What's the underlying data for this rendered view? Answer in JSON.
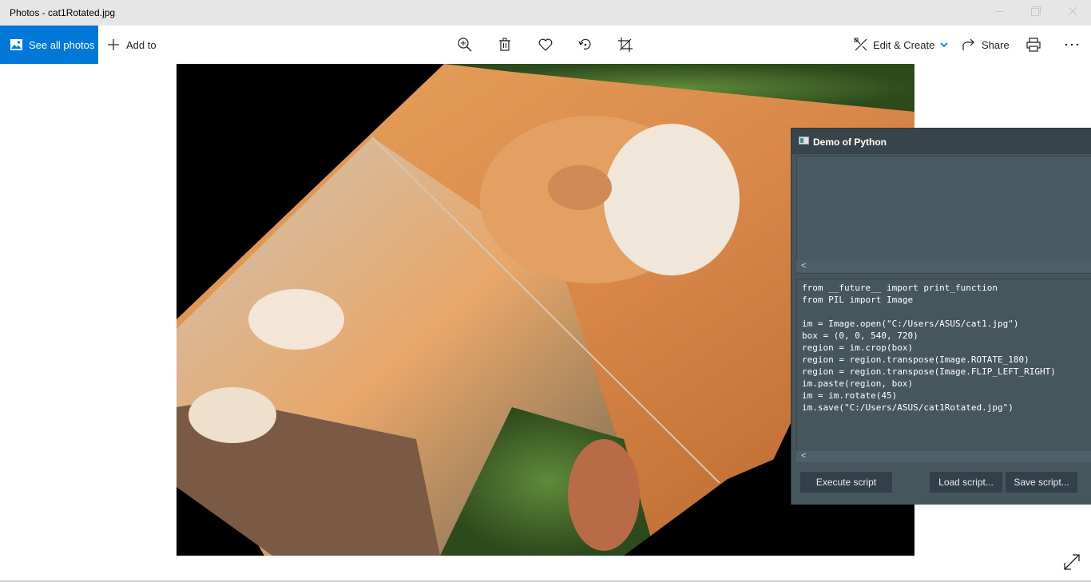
{
  "window": {
    "title": "Photos - cat1Rotated.jpg",
    "controls": [
      "minimize-icon",
      "maximize-icon",
      "close-icon"
    ]
  },
  "toolbar": {
    "see_all_photos": "See all photos",
    "add_to": "Add to",
    "edit_create": "Edit & Create",
    "share": "Share",
    "accent_color": "#0078d7",
    "icons": [
      "zoom-in-icon",
      "delete-icon",
      "favorite-icon",
      "rotate-icon",
      "crop-icon",
      "print-icon",
      "more-icon"
    ]
  },
  "python_window": {
    "title": "Demo of Python",
    "code_lines": [
      "from __future__ import print_function",
      "from PIL import Image",
      "",
      "im = Image.open(\"C:/Users/ASUS/cat1.jpg\")",
      "box = (0, 0, 540, 720)",
      "region = im.crop(box)",
      "region = region.transpose(Image.ROTATE_180)",
      "region = region.transpose(Image.FLIP_LEFT_RIGHT)",
      "im.paste(region, box)",
      "im = im.rotate(45)",
      "im.save(\"C:/Users/ASUS/cat1Rotated.jpg\")"
    ],
    "scroll_arrow": "<",
    "buttons": {
      "execute": "Execute script",
      "load": "Load script...",
      "save": "Save script..."
    }
  }
}
